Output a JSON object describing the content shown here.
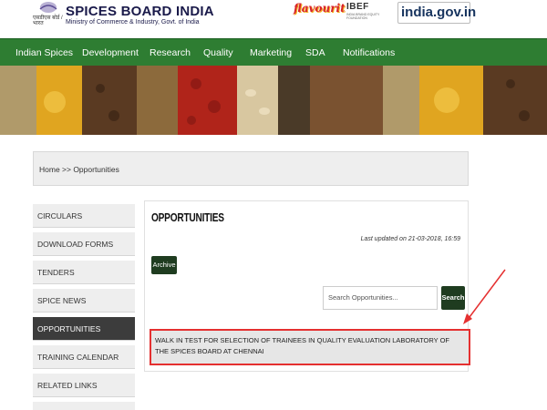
{
  "header": {
    "emblem_caption": "एसडीएस बोर्ड / भारत",
    "title": "SPICES BOARD INDIA",
    "subtitle": "Ministry of Commerce & Industry, Govt. of India",
    "partner_logos": {
      "flavourit": "flavourit",
      "ibef": "IBEF",
      "ibef_sub": "INDIA BRAND EQUITY FOUNDATION",
      "indiagov": "india.gov.in"
    }
  },
  "nav": {
    "items": [
      {
        "label": "Indian Spices"
      },
      {
        "label": "Development"
      },
      {
        "label": "Research"
      },
      {
        "label": "Quality"
      },
      {
        "label": "Marketing"
      },
      {
        "label": "SDA"
      },
      {
        "label": "Notifications"
      }
    ]
  },
  "breadcrumb": {
    "text": "Home >> Opportunities"
  },
  "sidebar": {
    "items": [
      {
        "label": "CIRCULARS"
      },
      {
        "label": "DOWNLOAD FORMS"
      },
      {
        "label": "TENDERS"
      },
      {
        "label": "SPICE NEWS"
      },
      {
        "label": "OPPORTUNITIES",
        "active": true
      },
      {
        "label": "TRAINING CALENDAR"
      },
      {
        "label": "RELATED LINKS"
      }
    ]
  },
  "main": {
    "title": "OPPORTUNITIES",
    "last_updated": "Last updated on 21-03-2018, 16:59",
    "archive_label": "Archive",
    "search_placeholder": "Search Opportunities...",
    "search_label": "Search",
    "listings": [
      {
        "text": "WALK IN TEST FOR SELECTION OF TRAINEES IN QUALITY EVALUATION LABORATORY OF THE SPICES BOARD AT CHENNAI"
      }
    ]
  },
  "colors": {
    "nav_green": "#2e7d32",
    "button_dark_green": "#1f3c20",
    "highlight_red": "#e53030",
    "sidebar_active": "#3c3c3c"
  }
}
